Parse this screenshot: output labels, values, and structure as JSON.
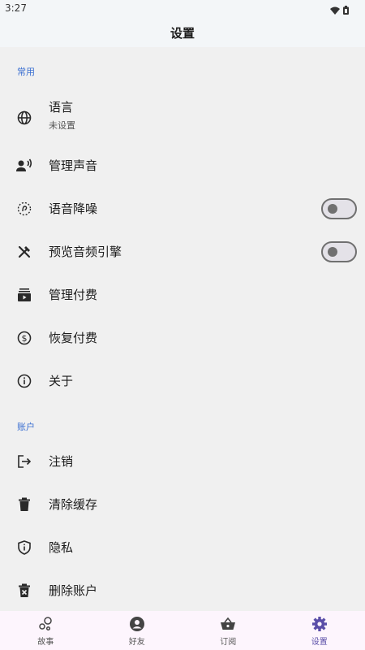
{
  "status_bar": {
    "time": "3:27"
  },
  "app_bar": {
    "title": "设置"
  },
  "sections": {
    "common": {
      "header": "常用",
      "language": {
        "label": "语言",
        "subtitle": "未设置"
      },
      "manage_voice": "管理声音",
      "noise_reduction": {
        "label": "语音降噪",
        "toggle_on": false
      },
      "preview_engine": {
        "label": "预览音频引擎",
        "toggle_on": false
      },
      "manage_payment": "管理付费",
      "restore_payment": "恢复付费",
      "about": "关于"
    },
    "account": {
      "header": "账户",
      "logout": "注销",
      "clear_cache": "清除缓存",
      "privacy": "隐私",
      "delete_account": "删除账户"
    }
  },
  "bottom_nav": [
    {
      "label": "故事",
      "icon": "bubbles-icon",
      "active": false
    },
    {
      "label": "好友",
      "icon": "person-icon",
      "active": false
    },
    {
      "label": "订阅",
      "icon": "basket-icon",
      "active": false
    },
    {
      "label": "设置",
      "icon": "gear-icon",
      "active": true
    }
  ],
  "colors": {
    "accent": "#5a4ea8",
    "section_header": "#3b6fd1",
    "background": "#f0f0f0",
    "nav_background": "#fdf5fd"
  }
}
